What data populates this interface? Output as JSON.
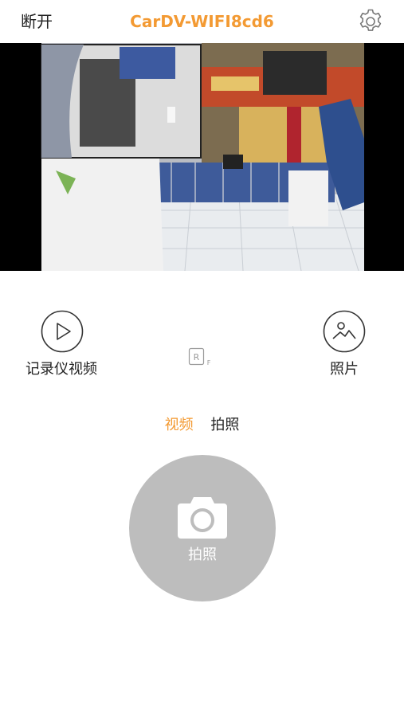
{
  "header": {
    "disconnect_label": "断开",
    "title": "CarDV-WIFI8cd6",
    "settings_icon": "gear-icon"
  },
  "colors": {
    "accent": "#f39a33",
    "text": "#222222",
    "shutter": "#bdbdbd",
    "icon_stroke": "#333333"
  },
  "controls": {
    "recorder_video": {
      "icon": "play-icon",
      "label": "记录仪视频"
    },
    "photos": {
      "icon": "image-icon",
      "label": "照片"
    },
    "rf_icon": "rf-icon"
  },
  "mode_tabs": [
    {
      "label": "视频",
      "active": true
    },
    {
      "label": "拍照",
      "active": false
    }
  ],
  "shutter": {
    "icon": "camera-icon",
    "label": "拍照"
  }
}
